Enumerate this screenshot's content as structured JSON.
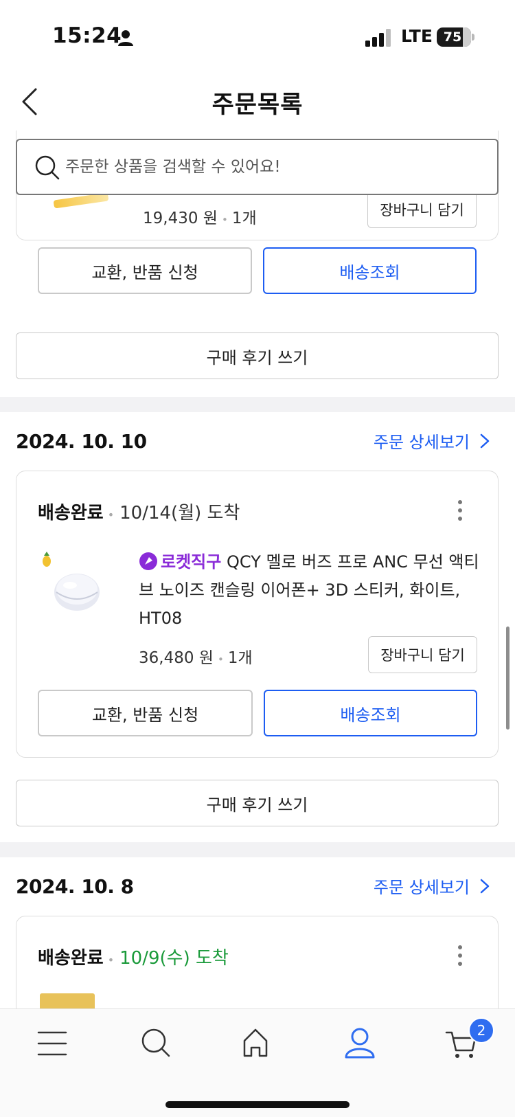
{
  "status_bar": {
    "time": "15:24",
    "network": "LTE",
    "battery": "75"
  },
  "header": {
    "title": "주문목록"
  },
  "search": {
    "placeholder": "주문한 상품을 검색할 수 있어요!"
  },
  "partial_order": {
    "price": "19,430 원",
    "qty": "1개",
    "cart_label": "장바구니 담기",
    "return_label": "교환, 반품 신청",
    "tracking_label": "배송조회",
    "review_label": "구매 후기 쓰기"
  },
  "orders": [
    {
      "date": "2024. 10. 10",
      "detail_label": "주문 상세보기",
      "status": "배송완료",
      "arrival": "10/14(월) 도착",
      "badge": "로켓직구",
      "product_name": "QCY 멜로 버즈 프로 ANC 무선 액티브 노이즈 캔슬링 이어폰+ 3D 스티커, 화이트, HT08",
      "price": "36,480 원",
      "qty": "1개",
      "cart_label": "장바구니 담기",
      "return_label": "교환, 반품 신청",
      "tracking_label": "배송조회",
      "review_label": "구매 후기 쓰기"
    },
    {
      "date": "2024. 10. 8",
      "detail_label": "주문 상세보기",
      "status": "배송완료",
      "arrival": "10/9(수) 도착",
      "arrival_color": "#1a9a3a"
    }
  ],
  "tab_bar": {
    "items": [
      "menu-icon",
      "search-icon",
      "home-icon",
      "my-page-icon",
      "cart-icon"
    ],
    "active": "my-page-icon",
    "cart_count": "2"
  },
  "colors": {
    "accent": "#1d5df2",
    "rocket_purple": "#8a2bd8",
    "arrival_green": "#1a9a3a"
  }
}
